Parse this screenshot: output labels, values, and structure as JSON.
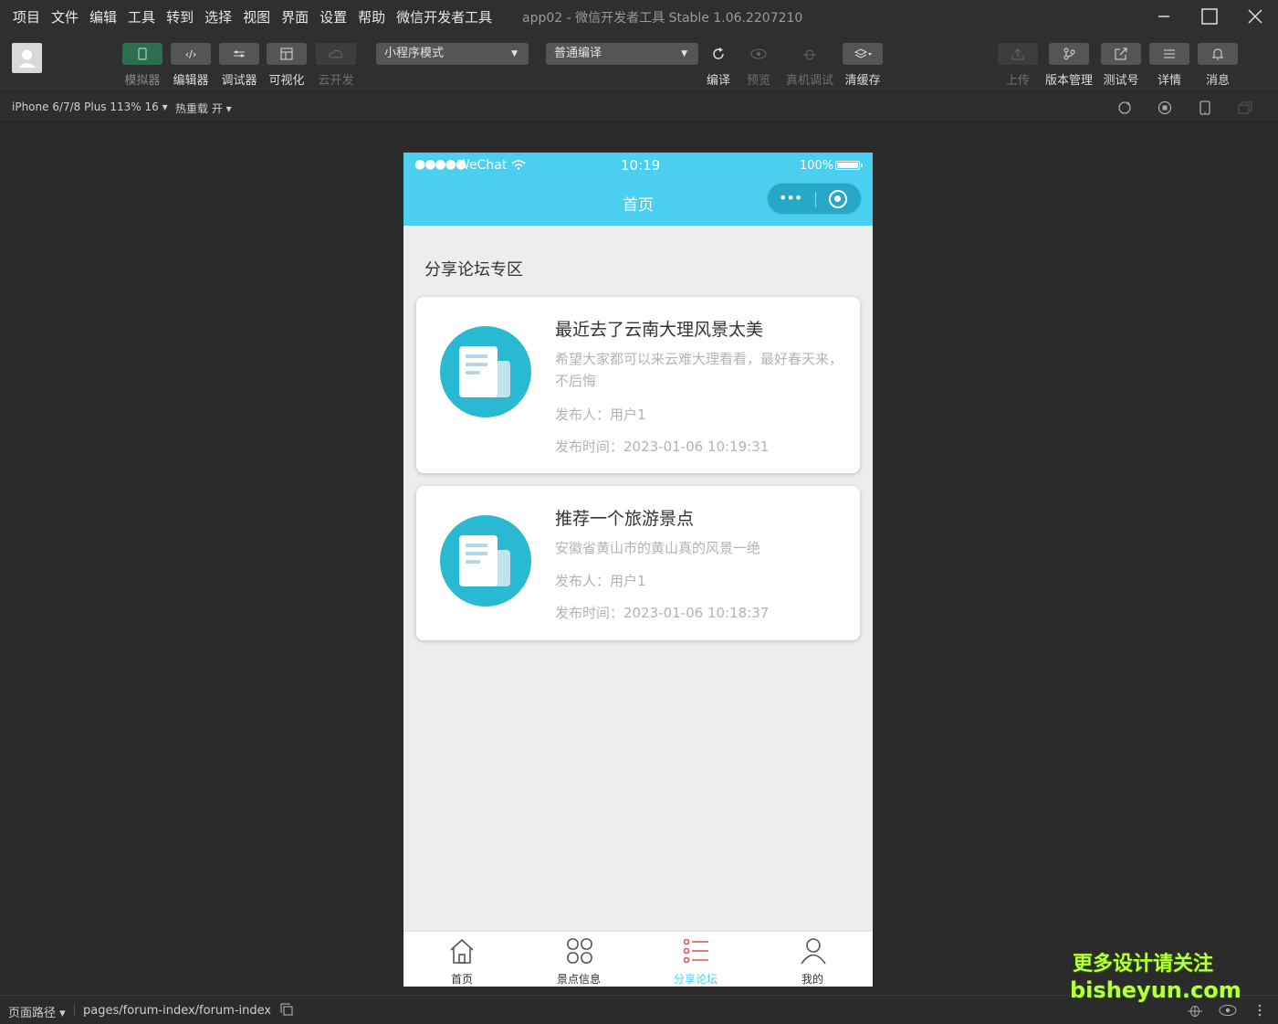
{
  "menu": [
    "项目",
    "文件",
    "编辑",
    "工具",
    "转到",
    "选择",
    "视图",
    "界面",
    "设置",
    "帮助",
    "微信开发者工具"
  ],
  "window_title": "app02 - 微信开发者工具 Stable 1.06.2207210",
  "toolbar": {
    "simulator": "模拟器",
    "editor": "编辑器",
    "debugger": "调试器",
    "visual": "可视化",
    "cloud": "云开发",
    "mode_select": "小程序模式",
    "compile_select": "普通编译",
    "compile": "编译",
    "preview": "预览",
    "real_debug": "真机调试",
    "clear_cache": "清缓存",
    "upload": "上传",
    "version": "版本管理",
    "test_account": "测试号",
    "details": "详情",
    "messages": "消息"
  },
  "subbar": {
    "device": "iPhone 6/7/8 Plus 113% 16 ▾",
    "hot_reload": "热重载 开 ▾"
  },
  "phone": {
    "signal": "●●●●●",
    "carrier": "WeChat",
    "time": "10:19",
    "battery": "100%",
    "nav_title": "首页",
    "capsule_dots": "•••",
    "section_title": "分享论坛专区",
    "posts": [
      {
        "title": "最近去了云南大理风景太美",
        "desc": "希望大家都可以来云难大理看看，最好春天来，不后悔",
        "author": "发布人：用户1",
        "time": "发布时间：2023-01-06 10:19:31"
      },
      {
        "title": "推荐一个旅游景点",
        "desc": "安徽省黄山市的黄山真的风景一绝",
        "author": "发布人：用户1",
        "time": "发布时间：2023-01-06 10:18:37"
      }
    ],
    "tabs": [
      {
        "label": "首页",
        "icon": "home-icon"
      },
      {
        "label": "景点信息",
        "icon": "grid-icon"
      },
      {
        "label": "分享论坛",
        "icon": "list-icon",
        "active": true
      },
      {
        "label": "我的",
        "icon": "user-icon"
      }
    ]
  },
  "bottombar": {
    "path_label": "页面路径 ▾",
    "page_path": "pages/forum-index/forum-index"
  },
  "watermark": {
    "line1": "更多设计请关注",
    "line2": "bisheyun.com"
  },
  "colors": {
    "accent": "#4bcff0",
    "icon_circle": "#2ab9d3",
    "ide_bg": "#2b2b2b"
  }
}
